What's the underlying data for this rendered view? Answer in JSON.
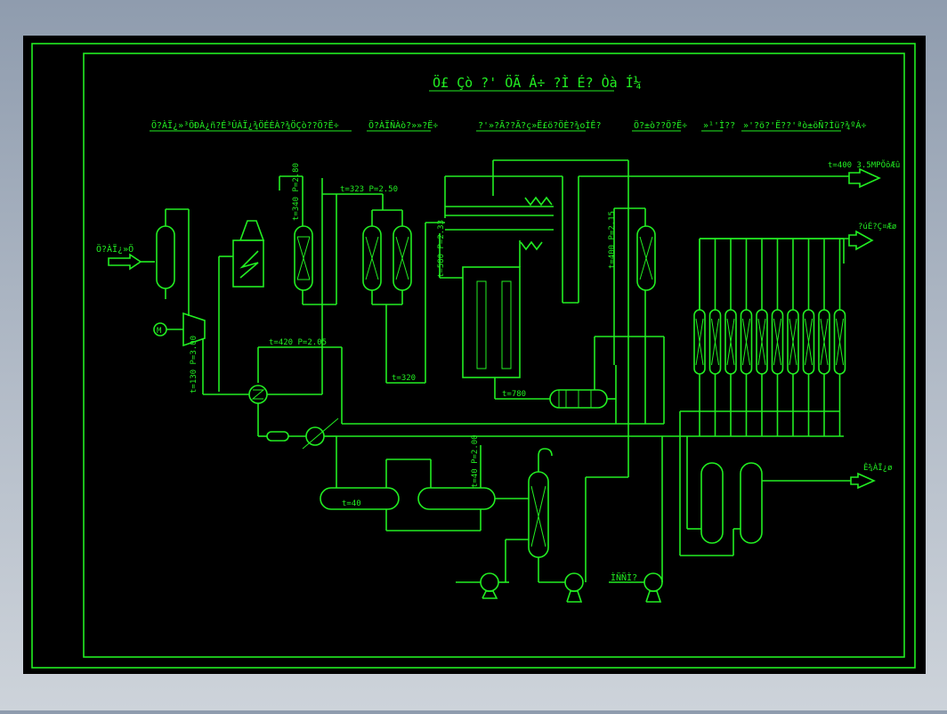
{
  "colors": {
    "background": "#000000",
    "line": "#22ee22",
    "frame_outer": "#8f9cae"
  },
  "title": "Ö£ Çò ?' ÖÃ Á÷ ?Ì É? Òà Í¼",
  "header_labels": [
    "Ö?ÀÏ¿»³ÖÐÀ¿ñ?É³ÛÀÏ¿¾ÖÉÈÀ?¾ÖÇò??Ö?Ë÷",
    "Ö?ÀÏÑÀò?»»?Ë÷",
    "?'»?Ã??Ã?ç»Ë£ö?ÖÈ?¾oÌÊ?",
    "Ö?±ò??Ö?Ë÷",
    "»¹'Ì??",
    "»'?ö?'Ë??'ªò±öÑ?Ìü?¾ºÁ÷"
  ],
  "stream_labels": {
    "feed_in": "Ö?ÀÏ¿»Ö",
    "steam_out": "t=400  3.5MPÕôÆû",
    "hydrogen_out": "?úÉ?Ç¤Æø",
    "product_out": "Ê¾ÀÏ¿ø",
    "pump_note": "ÌÑÑÌ?"
  },
  "condition_labels": [
    {
      "id": "reactor1",
      "text": "t=340   P=2.80"
    },
    {
      "id": "reactor-pair-inlet",
      "text": "t=323   P=2.50"
    },
    {
      "id": "furnace-inlet",
      "text": "t=580   P=2.33"
    },
    {
      "id": "column-right",
      "text": "t=400   P=2.15"
    },
    {
      "id": "compressor",
      "text": "t=130   P=3.00"
    },
    {
      "id": "exchanger-loop",
      "text": "t=420    P=2.05"
    },
    {
      "id": "reactor-pair-outlet",
      "text": "t=320"
    },
    {
      "id": "waste-boiler",
      "text": "t=780"
    },
    {
      "id": "drum1",
      "text": "t=40"
    },
    {
      "id": "separator",
      "text": "t=40   P=2.00"
    }
  ],
  "icons": {
    "motor": "M"
  }
}
